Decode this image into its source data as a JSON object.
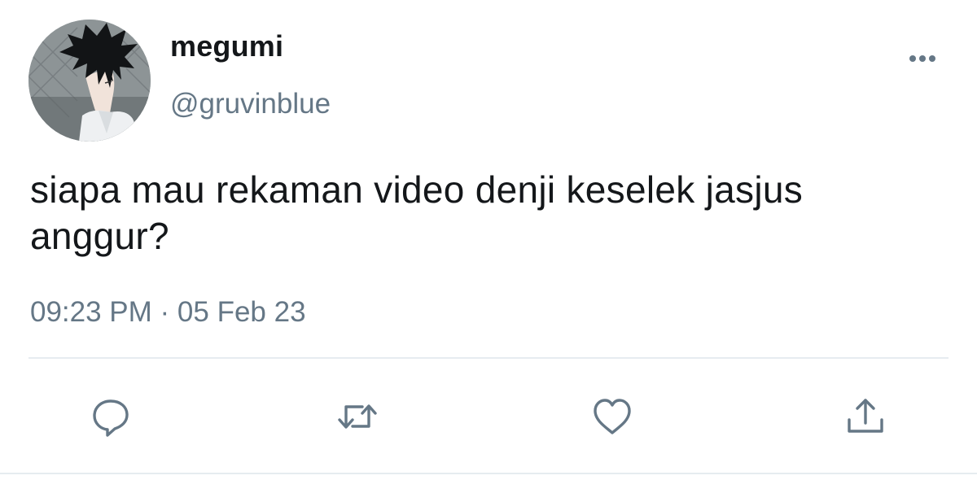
{
  "tweet": {
    "author": {
      "display_name": "megumi",
      "handle": "@gruvinblue",
      "avatar": "anime-character-avatar"
    },
    "text": "siapa mau rekaman video denji keselek jasjus anggur?",
    "timestamp": "09:23 PM · 05 Feb 23"
  },
  "actions": [
    {
      "name": "reply",
      "icon": "reply-icon"
    },
    {
      "name": "retweet",
      "icon": "retweet-icon"
    },
    {
      "name": "like",
      "icon": "heart-icon"
    },
    {
      "name": "share",
      "icon": "share-icon"
    }
  ],
  "colors": {
    "text": "#14171a",
    "secondary": "#657786",
    "icon": "#657786",
    "divider": "#e6ecf0"
  }
}
